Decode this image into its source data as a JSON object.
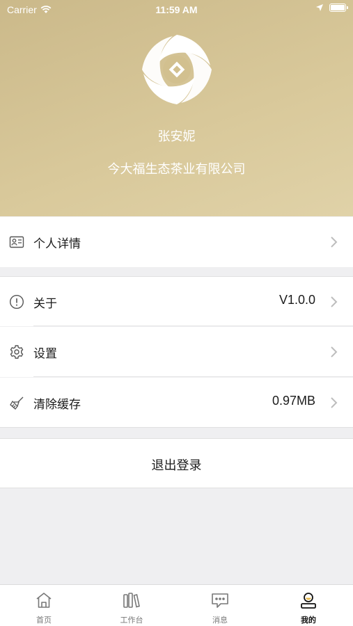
{
  "status_bar": {
    "carrier": "Carrier",
    "time": "11:59 AM"
  },
  "profile": {
    "name": "张安妮",
    "company": "今大福生态茶业有限公司"
  },
  "menu": {
    "personal_details": {
      "label": "个人详情"
    },
    "about": {
      "label": "关于",
      "value": "V1.0.0"
    },
    "settings": {
      "label": "设置"
    },
    "clear_cache": {
      "label": "清除缓存",
      "value": "0.97MB"
    }
  },
  "logout": {
    "label": "退出登录"
  },
  "tabbar": {
    "items": [
      {
        "label": "首页",
        "icon": "home-icon"
      },
      {
        "label": "工作台",
        "icon": "workbench-icon"
      },
      {
        "label": "消息",
        "icon": "message-icon"
      },
      {
        "label": "我的",
        "icon": "profile-icon",
        "active": true
      }
    ]
  },
  "colors": {
    "header_bg": "#d4c394",
    "page_bg": "#efeff1"
  }
}
